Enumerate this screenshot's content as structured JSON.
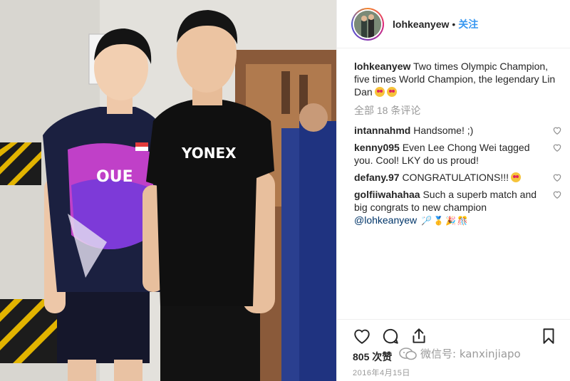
{
  "post": {
    "username": "lohkeanyew",
    "follow_label": "关注",
    "dot": "•",
    "caption": "Two times Olympic Champion, five times World Champion, the legendary Lin Dan",
    "view_all_comments": "全部 18 条评论",
    "comments": [
      {
        "user": "intannahmd",
        "text": "Handsome! ;)"
      },
      {
        "user": "kenny095",
        "text": "Even Lee Chong Wei tagged you. Cool! LKY do us proud!"
      },
      {
        "user": "defany.97",
        "text": "CONGRATULATIONS!!!"
      },
      {
        "user": "golfiiwahahaa",
        "text": "Such a superb match and big congrats to new champion",
        "mention": "@lohkeanyew"
      }
    ],
    "likes": "805 次赞",
    "date": "2016年4月15日"
  },
  "photo": {
    "jersey_text": "OUE",
    "shirt_text": "YONEX"
  },
  "watermark": "微信号: kanxinjiapo",
  "icons": {
    "like": "heart-outline-icon",
    "comment": "speech-bubble-icon",
    "share": "share-upload-icon",
    "save": "bookmark-icon"
  },
  "colors": {
    "link": "#3897f0",
    "text": "#262626",
    "muted": "#999999",
    "mention": "#003569"
  }
}
